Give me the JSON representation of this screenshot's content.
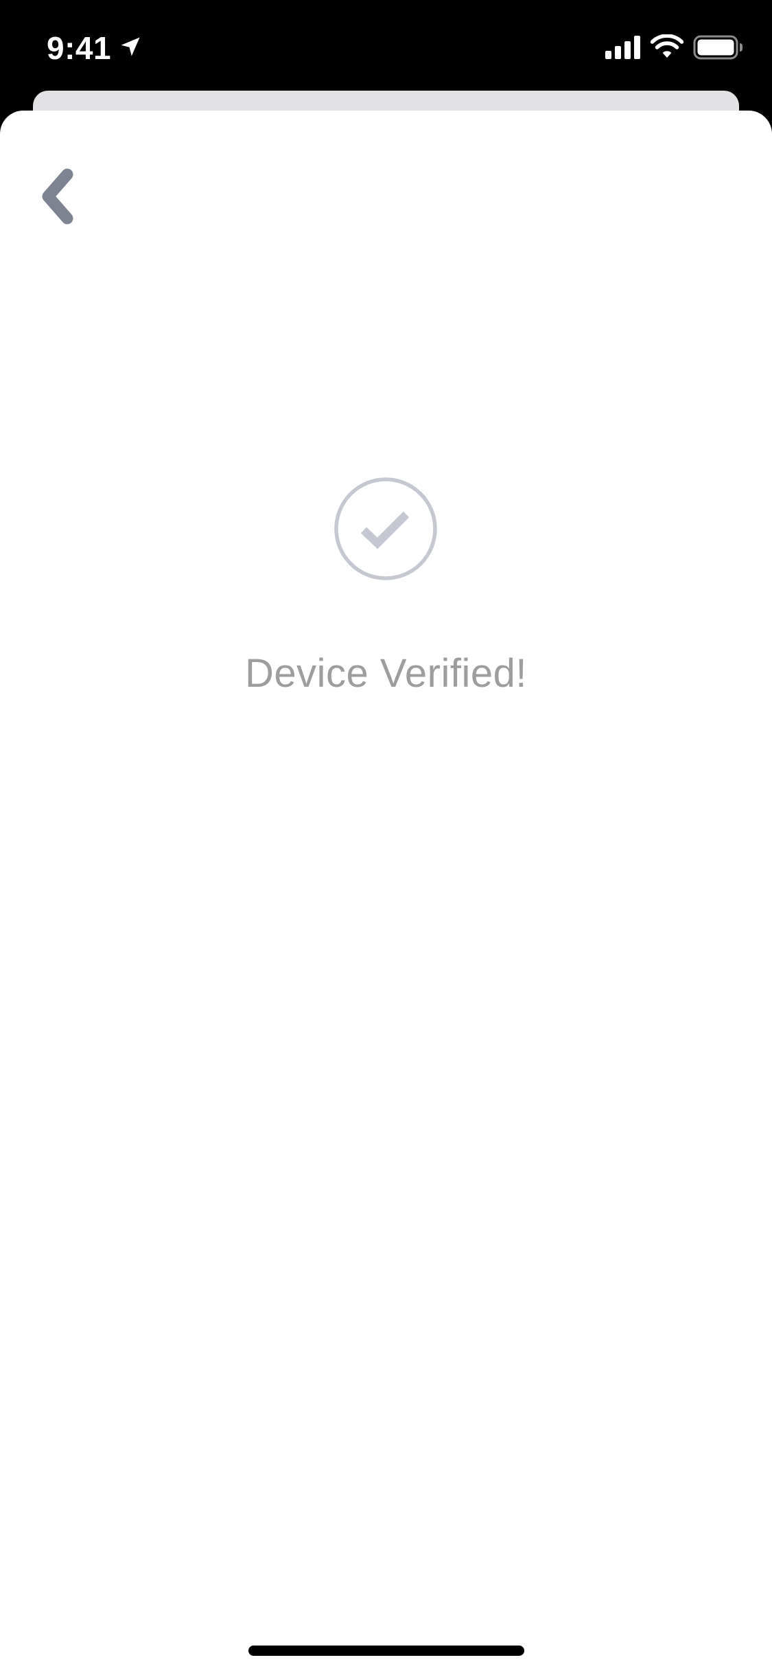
{
  "status_bar": {
    "time": "9:41",
    "icons": [
      "location-arrow-icon",
      "cellular-signal-icon",
      "wifi-icon",
      "battery-icon"
    ]
  },
  "navigation": {
    "back_icon": "chevron-left-icon"
  },
  "main": {
    "status_icon": "check-circle-icon",
    "message": "Device Verified!"
  },
  "colors": {
    "status_bar_background": "#000000",
    "sheet_background": "#ffffff",
    "back_card": "#e2e2e4",
    "back_chevron": "#7d8390",
    "check_icon": "#c5c8d0",
    "message_text": "#9d9d9f",
    "home_indicator": "#000000"
  }
}
